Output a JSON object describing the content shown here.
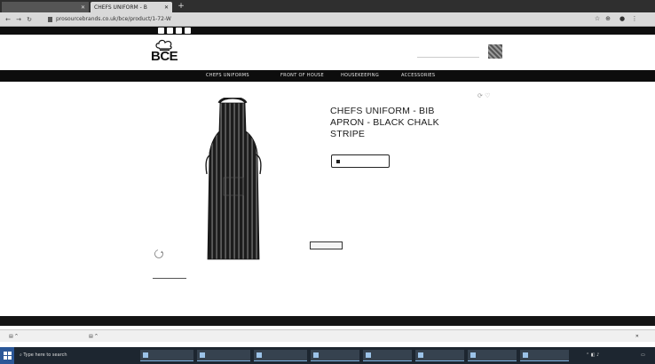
{
  "browser": {
    "tabs": [
      {
        "label": "",
        "active": false
      },
      {
        "label": "CHEFS UNIFORM - B",
        "active": true
      }
    ],
    "url": "prosourcebrands.co.uk/bce/product/1-72-W",
    "icons": [
      "back-icon",
      "forward-icon",
      "reload-icon",
      "star-icon",
      "extensions-icon",
      "profile-icon",
      "menu-icon"
    ]
  },
  "topbar": {
    "right_text": ""
  },
  "header": {
    "logo_text": "BCE",
    "search_placeholder": ""
  },
  "nav": {
    "items": [
      "CHEFS UNIFORMS",
      "FRONT OF HOUSE",
      "HOUSEKEEPING",
      "ACCESSORIES"
    ]
  },
  "product": {
    "breadcrumb": "",
    "title_lines": [
      "CHEFS UNIFORM - BIB",
      "APRON - BLACK CHALK",
      "STRIPE"
    ],
    "enquire_label": "",
    "code_line": "",
    "colour_line": "",
    "size_line": "",
    "swatch_label": "",
    "thumb_label": "",
    "note": ""
  },
  "footer": {
    "left_text": "",
    "center_text": ""
  },
  "downloads": {
    "items": [
      "",
      ""
    ],
    "show_all": ""
  },
  "taskbar": {
    "search_placeholder": "Type here to search",
    "apps": [
      "",
      "",
      "",
      "",
      "",
      "",
      "",
      ""
    ],
    "clock": ""
  },
  "colors": {
    "nav_bg": "#0d0d0d",
    "taskbar_bg": "#1d2630",
    "apron_stripe_dark": "#1c1c1c",
    "apron_stripe_light": "#9a9a9a"
  }
}
